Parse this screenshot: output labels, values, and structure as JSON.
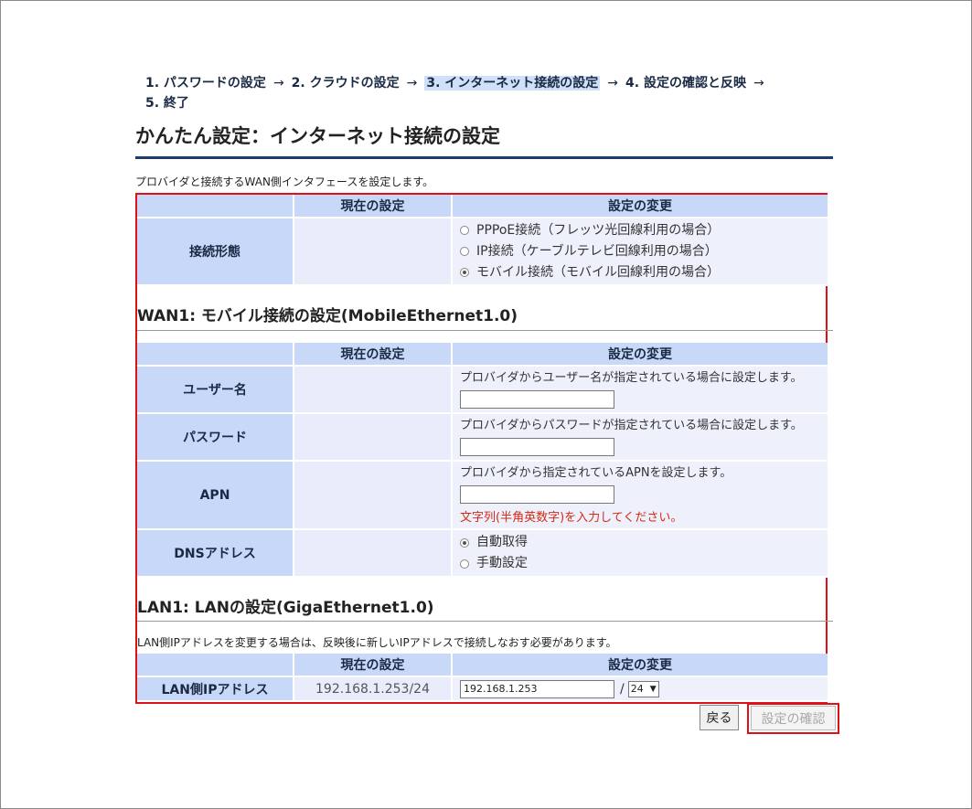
{
  "steps": [
    {
      "label": "1. パスワードの設定"
    },
    {
      "label": "2. クラウドの設定"
    },
    {
      "label": "3. インターネット接続の設定"
    },
    {
      "label": "4. 設定の確認と反映"
    },
    {
      "label": "5. 終了"
    }
  ],
  "steps_arrow": "→",
  "page_title": "かんたん設定：インターネット接続の設定",
  "intro_text": "プロバイダと接続するWAN側インタフェースを設定します。",
  "headers": {
    "current": "現在の設定",
    "change": "設定の変更"
  },
  "connection": {
    "label": "接続形態",
    "options": [
      {
        "label": "PPPoE接続（フレッツ光回線利用の場合）",
        "selected": false
      },
      {
        "label": "IP接続（ケーブルテレビ回線利用の場合）",
        "selected": false
      },
      {
        "label": "モバイル接続（モバイル回線利用の場合）",
        "selected": true
      }
    ]
  },
  "wan_section": {
    "title": "WAN1: モバイル接続の設定(MobileEthernet1.0)",
    "username": {
      "label": "ユーザー名",
      "desc": "プロバイダからユーザー名が指定されている場合に設定します。",
      "value": ""
    },
    "password": {
      "label": "パスワード",
      "desc": "プロバイダからパスワードが指定されている場合に設定します。",
      "value": ""
    },
    "apn": {
      "label": "APN",
      "desc": "プロバイダから指定されているAPNを設定します。",
      "value": "",
      "warning": "文字列(半角英数字)を入力してください。"
    },
    "dns": {
      "label": "DNSアドレス",
      "options": [
        {
          "label": "自動取得",
          "selected": true
        },
        {
          "label": "手動設定",
          "selected": false
        }
      ]
    }
  },
  "lan_section": {
    "title": "LAN1: LANの設定(GigaEthernet1.0)",
    "note": "LAN側IPアドレスを変更する場合は、反映後に新しいIPアドレスで接続しなおす必要があります。",
    "ip": {
      "label": "LAN側IPアドレス",
      "current": "192.168.1.253/24",
      "value": "192.168.1.253",
      "slash": "/",
      "prefix": "24"
    }
  },
  "buttons": {
    "back": "戻る",
    "confirm": "設定の確認"
  },
  "colors": {
    "accent": "#1b3d6b",
    "highlight_border": "#e0101a",
    "header_bg": "#c8d8f8",
    "warning": "#d62a12"
  }
}
